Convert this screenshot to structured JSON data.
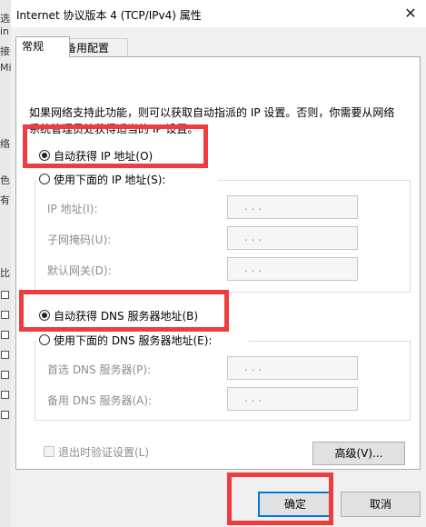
{
  "background_window": {
    "glyphs": [
      "选",
      "in",
      "接",
      "Mi",
      "色",
      "络",
      "有",
      "比"
    ]
  },
  "dialog": {
    "title": "Internet 协议版本 4 (TCP/IPv4) 属性",
    "close_glyph": "✕",
    "tabs": [
      {
        "label": "常规",
        "active": true
      },
      {
        "label": "备用配置",
        "active": false
      }
    ],
    "intro_text": "如果网络支持此功能，则可以获取自动指派的 IP 设置。否则，你需要从网络系统管理员处获得适当的 IP 设置。",
    "ip_section": {
      "auto_label": "自动获得 IP 地址(O)",
      "manual_label": "使用下面的 IP 地址(S):",
      "selected": "auto",
      "fields": [
        {
          "label": "IP 地址(I):",
          "value": ". . ."
        },
        {
          "label": "子网掩码(U):",
          "value": ". . ."
        },
        {
          "label": "默认网关(D):",
          "value": ". . ."
        }
      ]
    },
    "dns_section": {
      "auto_label": "自动获得 DNS 服务器地址(B)",
      "manual_label": "使用下面的 DNS 服务器地址(E):",
      "selected": "auto",
      "fields": [
        {
          "label": "首选 DNS 服务器(P):",
          "value": ". . ."
        },
        {
          "label": "备用 DNS 服务器(A):",
          "value": ". . ."
        }
      ]
    },
    "validate_on_exit_label": "退出时验证设置(L)",
    "advanced_button": "高级(V)...",
    "ok_button": "确定",
    "cancel_button": "取消"
  },
  "colors": {
    "highlight": "#f03c3c",
    "disabled_text": "#8d8d8d",
    "button_bg": "#e1e1e1",
    "focus_blue": "#0078d7"
  }
}
